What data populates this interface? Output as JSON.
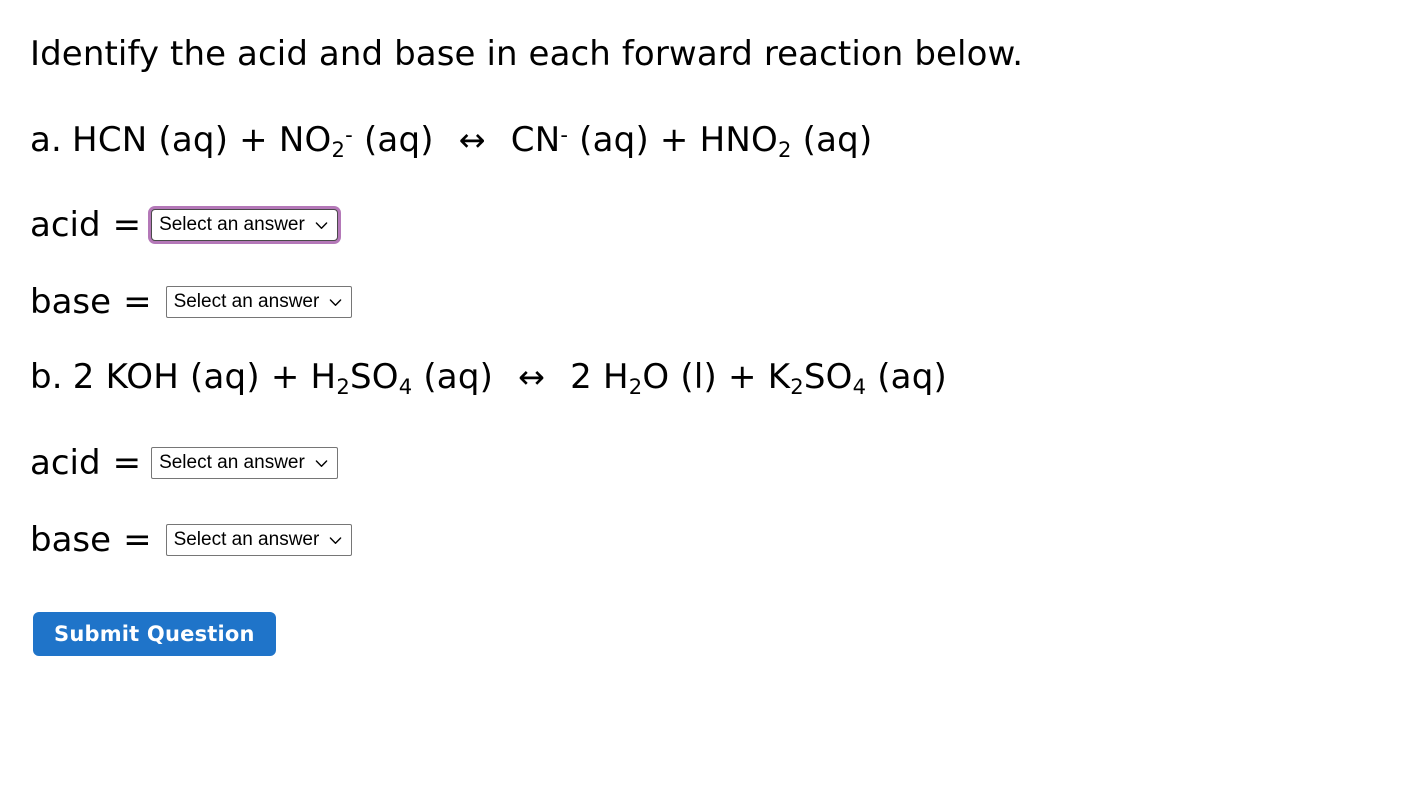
{
  "page": {
    "prompt": "Identify the acid and base in each forward reaction below."
  },
  "colors": {
    "focus_ring": "#b478b8",
    "submit_background": "#1f74c9",
    "submit_text": "#ffffff",
    "select_border": "#767676",
    "text": "#000000",
    "background": "#ffffff"
  },
  "questions": [
    {
      "id": "a",
      "marker": "a.",
      "equation": {
        "plain": "a. HCN (aq) + NO2- (aq)  <->  CN- (aq) + HNO2 (aq)",
        "reactants": [
          {
            "coefficient": "",
            "formula": "HCN",
            "sub1": "",
            "sup": "",
            "state": "(aq)"
          },
          {
            "coefficient": "",
            "formula": "NO",
            "sub1": "2",
            "sup": "-",
            "state": "(aq)"
          }
        ],
        "arrow": "↔",
        "products": [
          {
            "coefficient": "",
            "formula": "CN",
            "sub1": "",
            "sup": "-",
            "state": "(aq)"
          },
          {
            "coefficient": "",
            "formula": "HNO",
            "sub1": "2",
            "sup": "",
            "state": "(aq)"
          }
        ],
        "plus": "+"
      },
      "fields": [
        {
          "label": "acid",
          "equals": "=",
          "value": "Select an answer",
          "focused": true
        },
        {
          "label": "base",
          "equals": "=",
          "value": "Select an answer",
          "focused": false
        }
      ]
    },
    {
      "id": "b",
      "marker": "b.",
      "equation": {
        "plain": "b. 2 KOH (aq) + H2SO4 (aq)  <->  2 H2O (l) + K2SO4 (aq)",
        "reactants": [
          {
            "coefficient": "2",
            "formula": "KOH",
            "sub1": "",
            "sup": "",
            "state": "(aq)"
          },
          {
            "coefficient": "",
            "formula": "H",
            "sub1": "2",
            "formula2": "SO",
            "sub2": "4",
            "sup": "",
            "state": "(aq)"
          }
        ],
        "arrow": "↔",
        "products": [
          {
            "coefficient": "2",
            "formula": "H",
            "sub1": "2",
            "formula2": "O",
            "sub2": "",
            "sup": "",
            "state": "(l)"
          },
          {
            "coefficient": "",
            "formula": "K",
            "sub1": "2",
            "formula2": "SO",
            "sub2": "4",
            "sup": "",
            "state": "(aq)"
          }
        ],
        "plus": "+"
      },
      "fields": [
        {
          "label": "acid",
          "equals": "=",
          "value": "Select an answer",
          "focused": false
        },
        {
          "label": "base",
          "equals": "=",
          "value": "Select an answer",
          "focused": false
        }
      ]
    }
  ],
  "submit": {
    "label": "Submit Question"
  }
}
